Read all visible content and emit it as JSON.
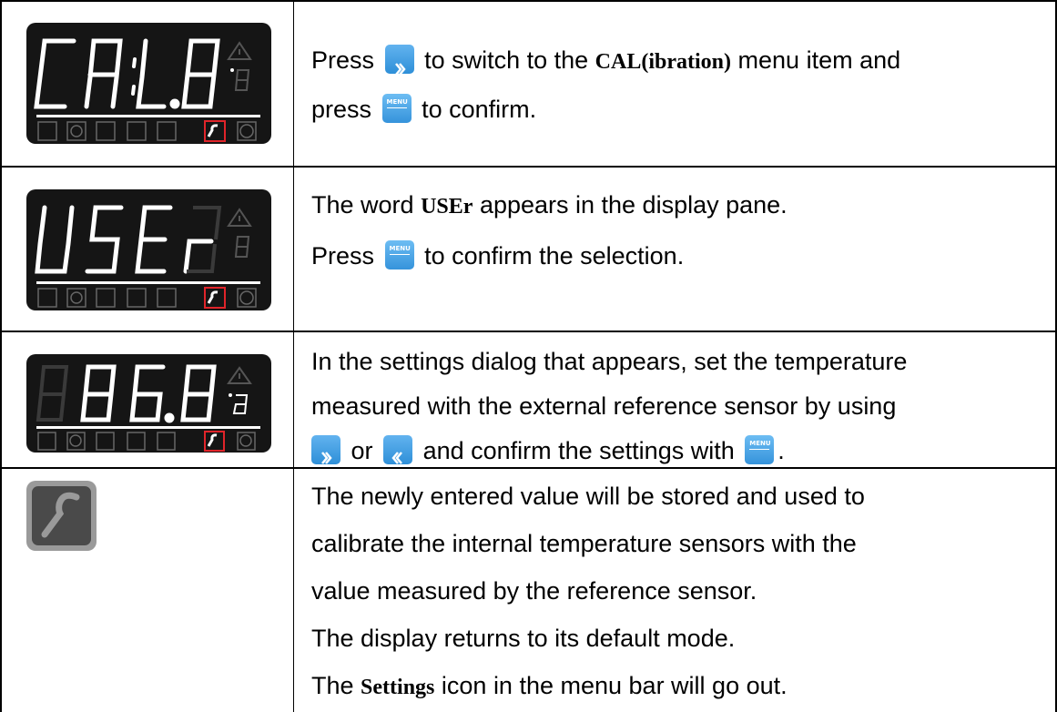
{
  "rows": [
    {
      "display_digits": "CAL.8",
      "line1": {
        "t1": "Press",
        "t2": "to switch to the",
        "term_bold": "CAL(ibration",
        "term_close": ")",
        "t3": "menu item and"
      },
      "line2": {
        "t1": "press",
        "t2": "to confirm."
      }
    },
    {
      "display_digits": "USEr",
      "line1": {
        "t1": "The word",
        "term": "USEr",
        "t2": "appears in the display pane."
      },
      "line2": {
        "t1": "Press",
        "t2": "to confirm the selection."
      }
    },
    {
      "display_digits": "86.8",
      "line1": "In the settings dialog that appears, set the temperature",
      "line2": "measured with the external reference sensor by using",
      "line3": {
        "t1": "or",
        "t2": "and confirm the settings with",
        "t3": "."
      }
    },
    {
      "line1": "The newly entered value will be stored and used to",
      "line2": "calibrate the internal temperature sensors with the",
      "line3": "value measured by the reference sensor.",
      "line4": "The display returns to its default mode.",
      "line5": {
        "t1": "The",
        "term": "Settings",
        "t2": "icon in the menu bar will go out."
      }
    }
  ],
  "menu_button_label": "MENU",
  "icons": {
    "forward": "forward-arrow-icon",
    "back": "back-arrow-icon",
    "menu_enter": "menu-enter-icon",
    "wrench": "wrench-icon"
  },
  "colors": {
    "button_blue": "#3593db",
    "highlight_red": "#e0242a",
    "display_bg": "#151515"
  }
}
